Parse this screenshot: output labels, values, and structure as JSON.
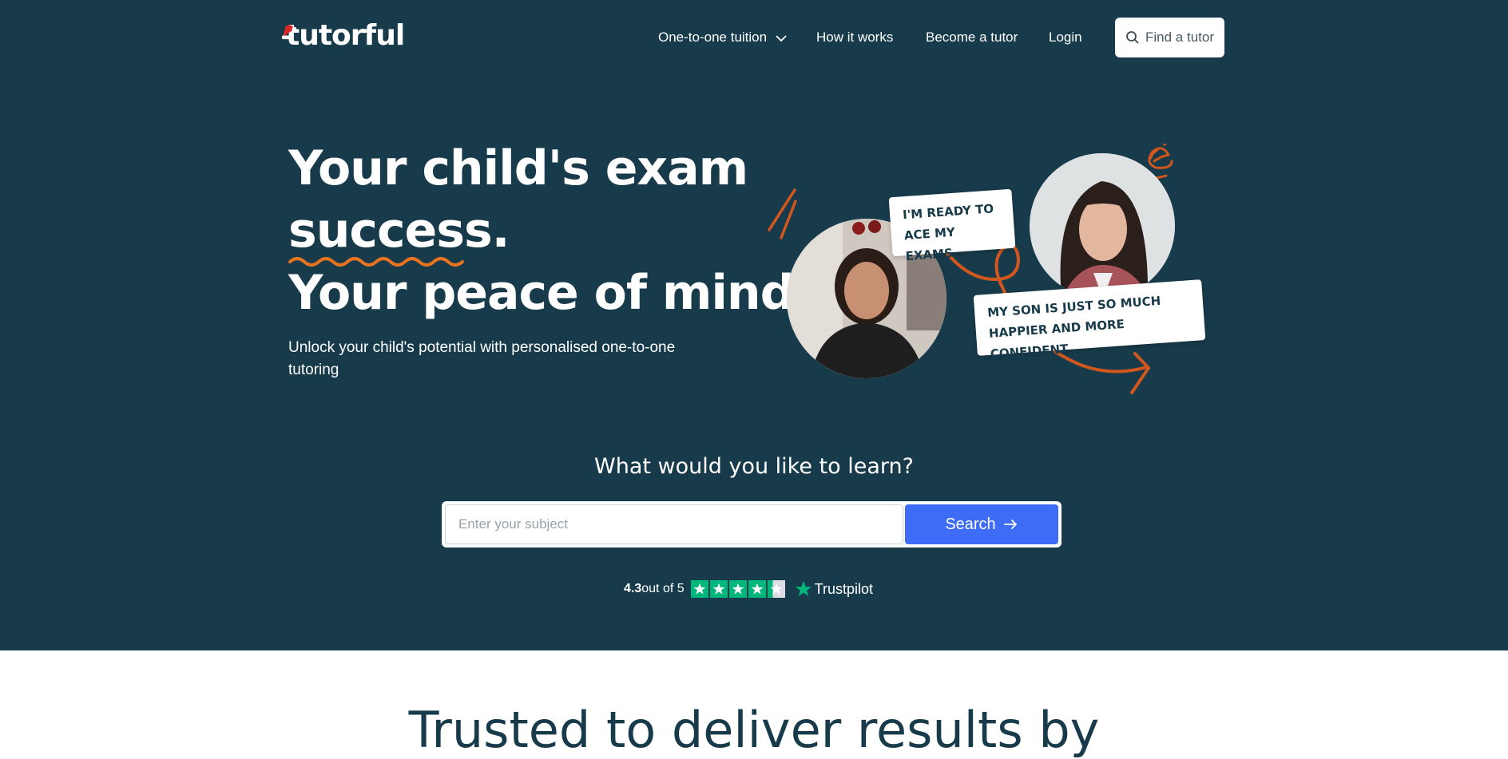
{
  "brand": {
    "logo_text": "tutorful"
  },
  "nav": {
    "items": [
      {
        "label": "One-to-one tuition"
      },
      {
        "label": "How it works"
      },
      {
        "label": "Become a tutor"
      },
      {
        "label": "Login"
      }
    ],
    "cta_label": "Find a tutor"
  },
  "hero": {
    "headline_line1": "Your child's exam",
    "headline_line2": "success.",
    "headline_line3": "Your peace of mind.",
    "subtext": "Unlock your child's potential with personalised one-to-one tutoring",
    "quote_student_line1": "I'M READY TO",
    "quote_student_line2": "ACE MY EXAMS",
    "quote_parent_line1": "MY SON IS JUST SO MUCH",
    "quote_parent_line2": "HAPPIER AND MORE CONFIDENT"
  },
  "search": {
    "question": "What would you like to learn?",
    "placeholder": "Enter your subject",
    "value": "",
    "button_label": "Search"
  },
  "rating": {
    "score": "4.3",
    "out_of": "out of 5",
    "stars_value": 4.3,
    "provider": "Trustpilot"
  },
  "next_section": {
    "heading": "Trusted to deliver results by"
  },
  "colors": {
    "hero_bg": "#173b4a",
    "accent_orange": "#d2571e",
    "search_blue": "#3e6cf7",
    "trustpilot_green": "#00b67a"
  }
}
